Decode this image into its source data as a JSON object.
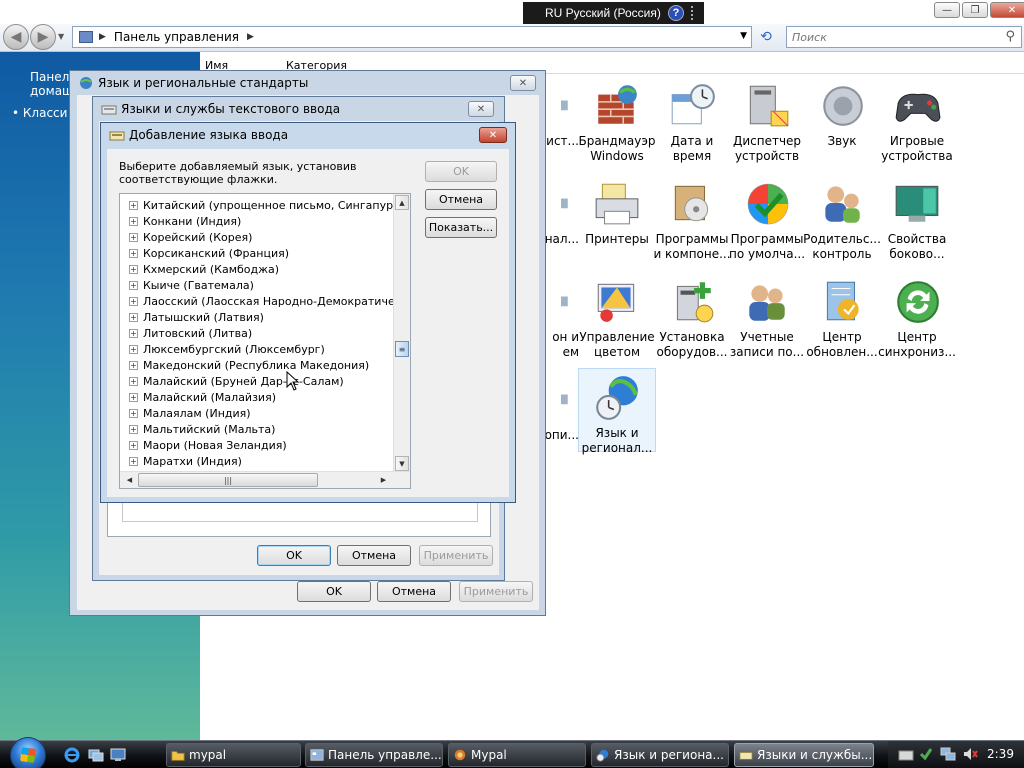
{
  "language_bar": {
    "label": "RU Русский (Россия)"
  },
  "address": {
    "crumb": "Панель управления",
    "search_placeholder": "Поиск"
  },
  "sidebar": {
    "title_line1": "Панель",
    "title_line2": "домаш",
    "item_classic": "Класси"
  },
  "columns": {
    "name": "Имя",
    "category": "Категория"
  },
  "control_panel_items": [
    {
      "line1": "ист...",
      "line2": "",
      "icon": "partial-icon"
    },
    {
      "line1": "Брандмауэр",
      "line2": "Windows",
      "icon": "firewall-icon"
    },
    {
      "line1": "Дата и",
      "line2": "время",
      "icon": "date-time-icon"
    },
    {
      "line1": "Диспетчер",
      "line2": "устройств",
      "icon": "device-manager-icon"
    },
    {
      "line1": "Звук",
      "line2": "",
      "icon": "sound-icon"
    },
    {
      "line1": "Игровые",
      "line2": "устройства",
      "icon": "game-controller-icon"
    },
    {
      "line1": "нал...",
      "line2": "",
      "icon": "partial-icon"
    },
    {
      "line1": "Принтеры",
      "line2": "",
      "icon": "printer-icon"
    },
    {
      "line1": "Программы",
      "line2": "и компоне...",
      "icon": "programs-features-icon"
    },
    {
      "line1": "Программы",
      "line2": "по умолча...",
      "icon": "default-programs-icon"
    },
    {
      "line1": "Родительс...",
      "line2": "контроль",
      "icon": "parental-controls-icon"
    },
    {
      "line1": "Свойства",
      "line2": "боково...",
      "icon": "sidebar-properties-icon"
    },
    {
      "line1": "он и",
      "line2": "ем",
      "icon": "partial-icon"
    },
    {
      "line1": "Управление",
      "line2": "цветом",
      "icon": "color-management-icon"
    },
    {
      "line1": "Установка",
      "line2": "оборудов...",
      "icon": "add-hardware-icon"
    },
    {
      "line1": "Учетные",
      "line2": "записи по...",
      "icon": "user-accounts-icon"
    },
    {
      "line1": "Центр",
      "line2": "обновлен...",
      "icon": "windows-update-icon"
    },
    {
      "line1": "Центр",
      "line2": "синхрониз...",
      "icon": "sync-center-icon"
    },
    {
      "line1": "опи...",
      "line2": "",
      "icon": "partial-icon"
    },
    {
      "line1": "Язык и",
      "line2": "регионал...",
      "icon": "regional-options-icon"
    }
  ],
  "dialog_regional": {
    "title": "Язык и региональные стандарты",
    "ok": "OK",
    "cancel": "Отмена",
    "apply": "Применить"
  },
  "dialog_text_services": {
    "title": "Языки и службы текстового ввода",
    "ok": "OK",
    "cancel": "Отмена",
    "apply": "Применить"
  },
  "dialog_add_language": {
    "title": "Добавление языка ввода",
    "instruction_line1": "Выберите добавляемый язык, установив",
    "instruction_line2": "соответствующие флажки.",
    "ok": "OK",
    "cancel": "Отмена",
    "show": "Показать...",
    "languages": [
      "Китайский (упрощенное письмо, Сингапур)",
      "Конкани (Индия)",
      "Корейский (Корея)",
      "Корсиканский (Франция)",
      "Кхмерский (Камбоджа)",
      "Кыиче (Гватемала)",
      "Лаосский (Лаосская Народно-Демократическая",
      "Латышский (Латвия)",
      "Литовский (Литва)",
      "Люксембургский (Люксембург)",
      "Македонский (Республика Македония)",
      "Малайский (Бруней Дар-эс-Салам)",
      "Малайский (Малайзия)",
      "Малаялам (Индия)",
      "Мальтийский (Мальта)",
      "Маори (Новая Зеландия)",
      "Маратхи (Индия)"
    ]
  },
  "taskbar": {
    "buttons": [
      {
        "label": "mypal",
        "icon": "folder-icon"
      },
      {
        "label": "Панель управле...",
        "icon": "control-panel-icon"
      },
      {
        "label": "Mypal",
        "icon": "browser-icon"
      },
      {
        "label": "Язык и регионa...",
        "icon": "regional-options-icon"
      },
      {
        "label": "Языки и службы...",
        "icon": "text-services-icon"
      }
    ],
    "clock": "2:39"
  },
  "colors": {
    "sidebar_top": "#0f5aa3",
    "sidebar_bottom": "#5fb99a",
    "close_red": "#c44a35"
  }
}
